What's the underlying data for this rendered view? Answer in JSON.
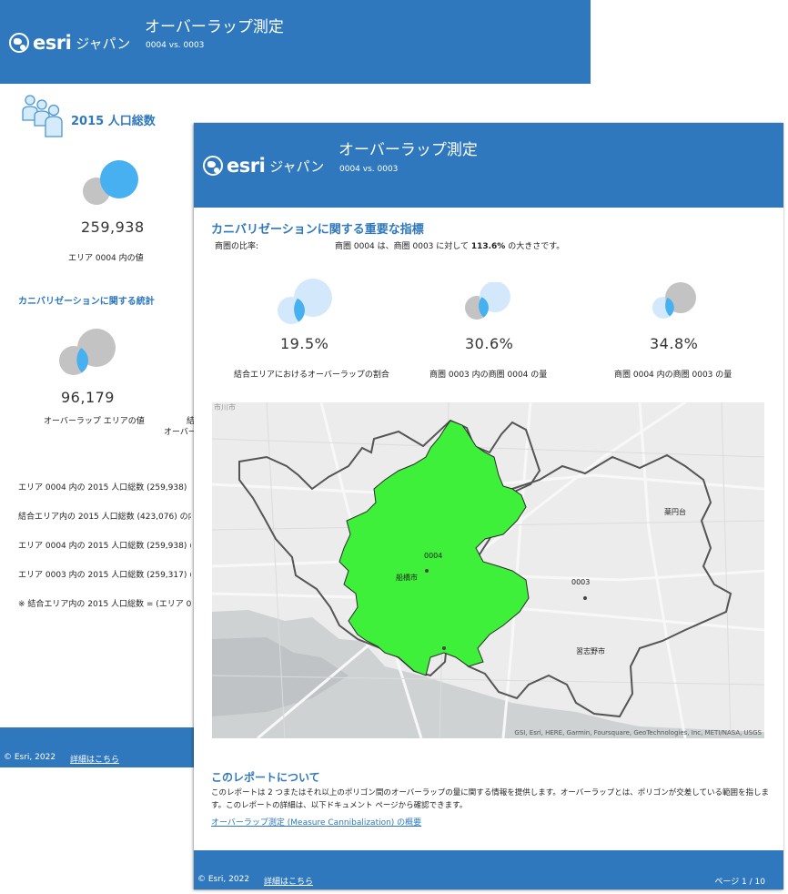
{
  "brand": {
    "esri": "esri",
    "jp": "ジャパン"
  },
  "back": {
    "title": "オーバーラップ測定",
    "subtitle": "0004 vs. 0003",
    "section_title": "2015 人口総数",
    "population_value": "259,938",
    "population_label": "エリア 0004 内の値",
    "stats_title": "カニバリゼーションに関する統計",
    "overlap_value": "96,179",
    "overlap_label": "オーバーラップ エリアの値",
    "cut_label_1": "結",
    "cut_label_2": "オーバーラ",
    "lines": [
      "エリア 0004 内の 2015 人口総数 (259,938)",
      "結合エリア内の 2015 人口総数 (423,076) の内",
      "エリア 0004 内の 2015 人口総数 (259,938) の",
      "エリア 0003 内の 2015 人口総数 (259,317) の",
      "※ 結合エリア内の 2015 人口総数 = (エリア 0"
    ],
    "footer": {
      "copyright": "© Esri, 2022",
      "more": "詳細はこちら"
    }
  },
  "front": {
    "title": "オーバーラップ測定",
    "subtitle": "0004 vs. 0003",
    "kpi_title": "カニバリゼーションに関する重要な指標",
    "ratio_label": "商圏の比率:",
    "ratio_pre": "商圏 0004 は、商圏 0003 に対して ",
    "ratio_value": "113.6%",
    "ratio_post": " の大きさです。",
    "kpis": [
      {
        "value": "19.5%",
        "label": "結合エリアにおけるオーバーラップの割合"
      },
      {
        "value": "30.6%",
        "label": "商圏 0003 内の商圏 0004 の量"
      },
      {
        "value": "34.8%",
        "label": "商圏 0004 内の商圏 0003 の量"
      }
    ],
    "map": {
      "labels": {
        "area_a": "0004",
        "area_b": "0003",
        "funabashi": "船橋市",
        "narashino": "習志野市",
        "yakuendai": "薬円台",
        "ichikawa": "市川市"
      },
      "attribution": "GSI, Esri, HERE, Garmin, Foursquare, GeoTechnologies, Inc, METI/NASA, USGS",
      "overlap_color": "#3ef03a"
    },
    "about": {
      "title": "このレポートについて",
      "text": "このレポートは 2 つまたはそれ以上のポリゴン間のオーバーラップの量に関する情報を提供します。オーバーラップとは、ポリゴンが交差している範囲を指します。このレポートの詳細は、以下ドキュメント ページから確認できます。",
      "link": "オーバーラップ測定 (Measure Cannibalization) の概要"
    },
    "footer": {
      "copyright": "© Esri, 2022",
      "more": "詳細はこちら",
      "page": "ページ 1 / 10"
    }
  },
  "colors": {
    "header": "#2f78bd",
    "accent_blue": "#47b0f0",
    "light_blue": "#d3e9fb",
    "gray": "#c3c3c3"
  }
}
